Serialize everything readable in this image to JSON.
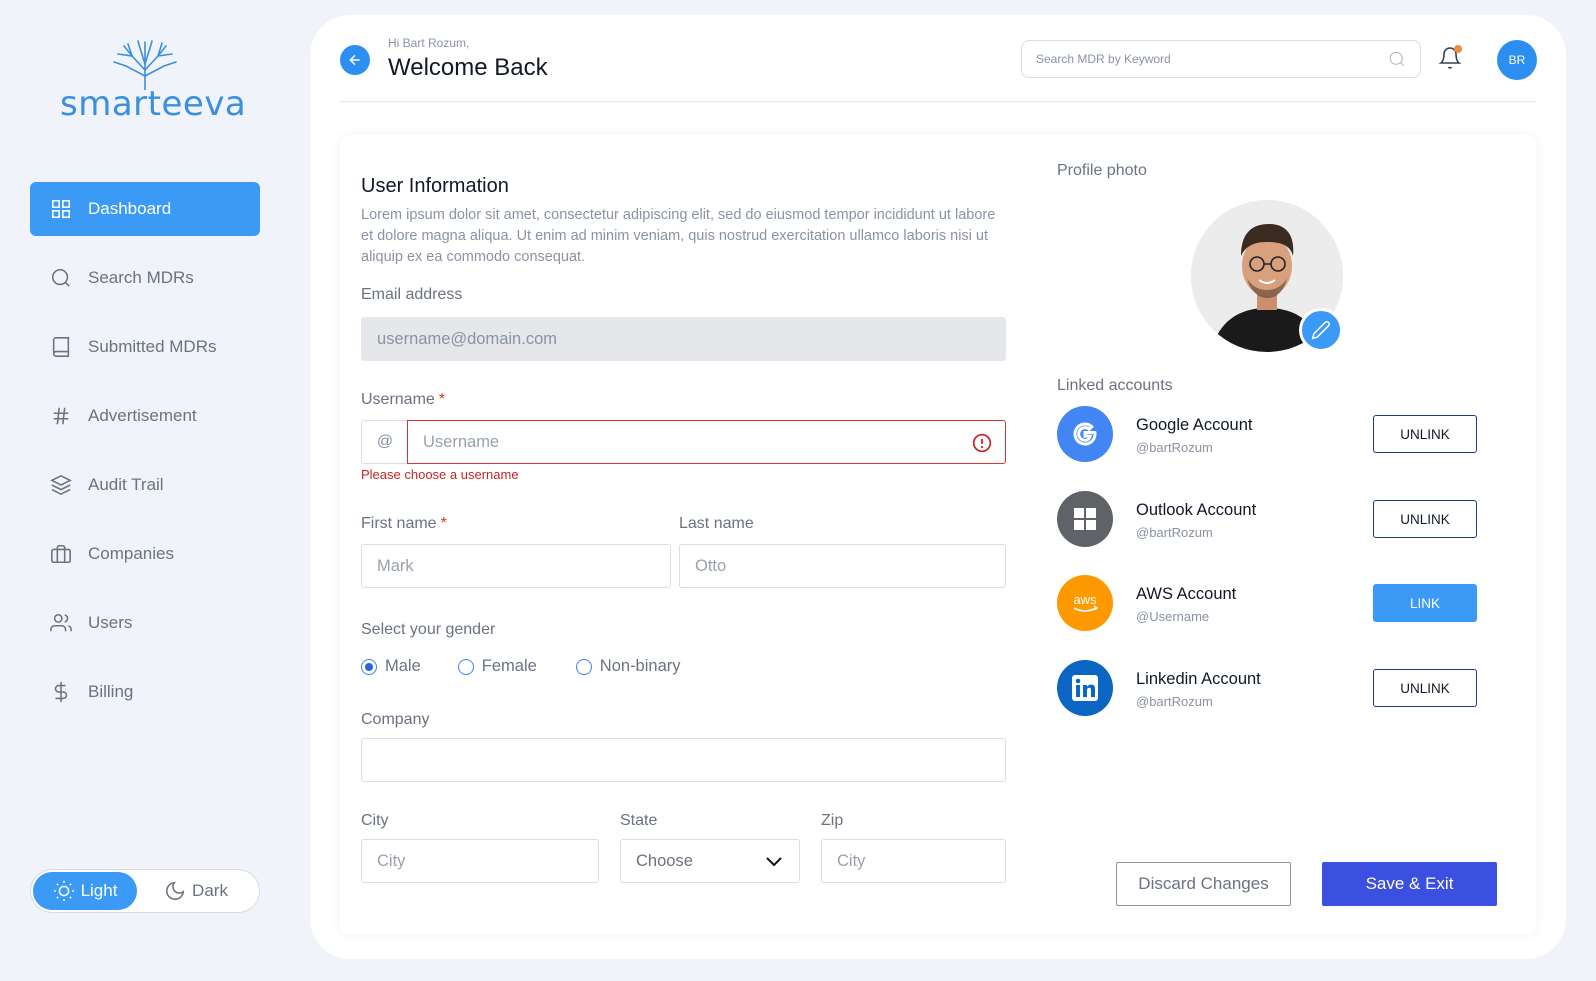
{
  "brand": {
    "name": "smarteeva",
    "color": "#3b8fe0"
  },
  "sidebar": {
    "items": [
      {
        "label": "Dashboard",
        "icon": "grid-icon",
        "active": true
      },
      {
        "label": "Search MDRs",
        "icon": "search-icon"
      },
      {
        "label": "Submitted MDRs",
        "icon": "book-icon"
      },
      {
        "label": "Advertisement",
        "icon": "hash-icon"
      },
      {
        "label": "Audit Trail",
        "icon": "layers-icon"
      },
      {
        "label": "Companies",
        "icon": "briefcase-icon"
      },
      {
        "label": "Users",
        "icon": "users-icon"
      },
      {
        "label": "Billing",
        "icon": "dollar-icon"
      }
    ],
    "theme": {
      "light": "Light",
      "dark": "Dark",
      "selected": "Light"
    }
  },
  "header": {
    "greeting": "Hi Bart Rozum,",
    "title": "Welcome Back",
    "search_placeholder": "Search MDR by Keyword",
    "avatar_initials": "BR"
  },
  "form": {
    "title": "User Information",
    "description": "Lorem ipsum dolor sit amet, consectetur adipiscing elit, sed do eiusmod tempor incididunt ut labore et dolore magna aliqua. Ut enim ad minim veniam, quis nostrud exercitation ullamco laboris nisi ut aliquip ex ea commodo consequat.",
    "email": {
      "label": "Email address",
      "placeholder": "username@domain.com",
      "value": ""
    },
    "username": {
      "label": "Username",
      "required": "*",
      "prefix": "@",
      "placeholder": "Username",
      "value": "",
      "error": "Please choose a username"
    },
    "first_name": {
      "label": "First name",
      "required": "*",
      "placeholder": "Mark",
      "value": ""
    },
    "last_name": {
      "label": "Last name",
      "placeholder": "Otto",
      "value": ""
    },
    "gender": {
      "label": "Select your gender",
      "options": [
        "Male",
        "Female",
        "Non-binary"
      ],
      "selected": "Male"
    },
    "company": {
      "label": "Company",
      "placeholder": "",
      "value": ""
    },
    "city": {
      "label": "City",
      "placeholder": "City",
      "value": ""
    },
    "state": {
      "label": "State",
      "value": "Choose"
    },
    "zip": {
      "label": "Zip",
      "placeholder": "City",
      "value": ""
    }
  },
  "profile": {
    "photo_label": "Profile photo",
    "linked_label": "Linked accounts",
    "accounts": [
      {
        "name": "Google Account",
        "handle": "@bartRozum",
        "action": "UNLINK",
        "color": "#4285f4",
        "icon": "google-icon"
      },
      {
        "name": "Outlook Account",
        "handle": "@bartRozum",
        "action": "UNLINK",
        "color": "#5f6368",
        "icon": "windows-icon"
      },
      {
        "name": "AWS Account",
        "handle": "@Username",
        "action": "LINK",
        "color": "#ff9900",
        "icon": "aws-icon"
      },
      {
        "name": "Linkedin Account",
        "handle": "@bartRozum",
        "action": "UNLINK",
        "color": "#0a66c2",
        "icon": "linkedin-icon"
      }
    ]
  },
  "actions": {
    "discard": "Discard Changes",
    "save": "Save & Exit"
  }
}
